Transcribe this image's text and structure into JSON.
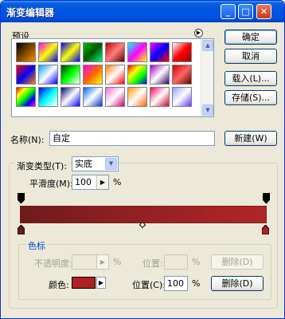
{
  "window": {
    "title": "渐变编辑器",
    "min": "_",
    "max": "□",
    "close": "✕"
  },
  "presets": {
    "label": "预设",
    "swatches": [
      "linear-gradient(135deg,#000,#ff8c00)",
      "linear-gradient(135deg,#ff00ff,#ffff00,#0000ff)",
      "linear-gradient(135deg,#00f,#ff0,#00f)",
      "linear-gradient(135deg,#00c000,#005500,#00ff80)",
      "linear-gradient(135deg,#c00000,#ff8080,#600000)",
      "linear-gradient(135deg,#00ffff,#ff00ff,#ffff00)",
      "linear-gradient(135deg,#ff00ff,#0000ff,#ff0000)",
      "linear-gradient(135deg,#ffffff,#ff0000,#990000)",
      "linear-gradient(135deg,#ff0000,#0000ff,#ff8800)",
      "linear-gradient(135deg,#00a0ff,#ffffff,#0000ff)",
      "linear-gradient(135deg,#004000,#00ff00,#ffffff)",
      "linear-gradient(135deg,#ff00ff,#ff6600,#ffff00)",
      "linear-gradient(135deg,#ff8000,#ffffff,#ff0000)",
      "linear-gradient(135deg,#ff0000,#ffff00,#00ff00,#0000ff)",
      "linear-gradient(135deg,#9900cc,#ffffff,#330066)",
      "linear-gradient(135deg,#cc0000,#ff6666,#660000)",
      "linear-gradient(135deg,#ff0000,#ffff00,#00ff00,#0000ff,#ff00ff)",
      "linear-gradient(135deg,#0000ff,#00ffff,#ffffff)",
      "linear-gradient(135deg,#000080,#ffffff,#0000ff)",
      "linear-gradient(135deg,#0066ff,#ffffff,#0033cc)",
      "linear-gradient(135deg,#ff66cc,#ffffff,#cc0066)",
      "linear-gradient(135deg,#ff9900,#ffffff,#ff6600)",
      "linear-gradient(135deg,#ff0066,#ffffff,#cc0033)",
      "linear-gradient(135deg,#9999ff,#ffffff,#6633ff)"
    ]
  },
  "buttons": {
    "ok": "确定",
    "cancel": "取消",
    "load": "载入(L)...",
    "save": "存储(S)...",
    "new": "新建(W)",
    "delete_opacity": "删除(D)",
    "delete_color": "删除(D)"
  },
  "name": {
    "label": "名称(N):",
    "value": "自定"
  },
  "gradient": {
    "type_label": "渐变类型(T):",
    "type_value": "实底",
    "smooth_label": "平滑度(M):",
    "smooth_value": "100",
    "percent": "%"
  },
  "stops": {
    "group_label": "色标",
    "opacity_label": "不透明度:",
    "opacity_value": "",
    "opacity_pct": "%",
    "location_label_opacity": "位置:",
    "location_opacity_value": "",
    "location_opacity_pct": "%",
    "color_label": "颜色:",
    "color_value": "#b01f24",
    "location_label_color": "位置(C):",
    "location_color_value": "100",
    "location_color_pct": "%"
  }
}
